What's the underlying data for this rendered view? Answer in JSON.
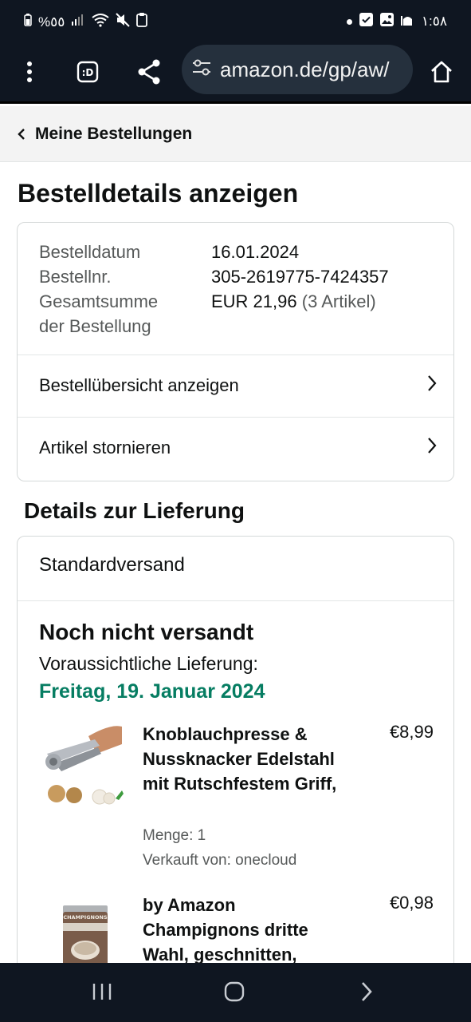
{
  "status_bar": {
    "battery_text": "%٥٥",
    "time": "١:٥٨"
  },
  "browser": {
    "url": "amazon.de/gp/aw/"
  },
  "breadcrumb": {
    "label": "Meine Bestellungen"
  },
  "page_title": "Bestelldetails anzeigen",
  "summary": {
    "date_label": "Bestelldatum",
    "date_value": "16.01.2024",
    "order_label": "Bestellnr.",
    "order_value": "305-2619775-7424357",
    "total_label_1": "Gesamtsumme",
    "total_label_2": "der Bestellung",
    "total_value": "EUR 21,96",
    "total_items": "(3 Artikel)",
    "overview_link": "Bestellübersicht anzeigen",
    "cancel_link": "Artikel stornieren"
  },
  "delivery": {
    "section_title": "Details zur Lieferung",
    "ship_method": "Standardversand",
    "status": "Noch nicht versandt",
    "eta_label": "Voraussichtliche Lieferung:",
    "eta_date": "Freitag, 19. Januar 2024",
    "items": [
      {
        "title": "Knoblauchpresse & Nussknacker Edelstahl mit Rutschfestem Griff,",
        "price": "€8,99",
        "quantity": "Menge: 1",
        "seller": "Verkauft von: onecloud"
      },
      {
        "title": "by Amazon Champignons dritte Wahl, geschnitten,",
        "price": "€0,98",
        "can_label": "CHAMPIGNONS"
      }
    ]
  },
  "colors": {
    "bar_bg": "#0f1621",
    "eta_green": "#067d62",
    "header_bg": "#f3f3f3"
  }
}
